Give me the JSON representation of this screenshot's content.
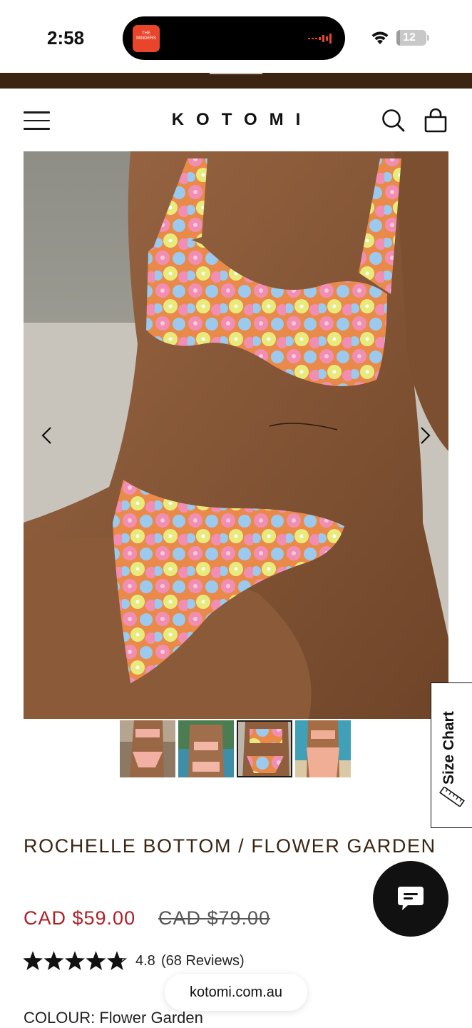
{
  "status_bar": {
    "time": "2:58",
    "now_playing_art_text": "THE MINDERS",
    "battery_level": "12",
    "battery_fraction": 0.12
  },
  "header": {
    "logo": "KOTOMI",
    "icons": [
      "menu-icon",
      "search-icon",
      "cart-icon"
    ]
  },
  "gallery": {
    "main_image_description": "floral bikini product photo",
    "thumbnail_count": 4,
    "active_thumbnail": 2
  },
  "size_chart": {
    "label": "Size Chart"
  },
  "product": {
    "title": "ROCHELLE BOTTOM / FLOWER GARDEN",
    "sale_price": "CAD $59.00",
    "original_price": "CAD $79.00",
    "rating_value": "4.8",
    "review_count": "(68 Reviews)",
    "rating_stars": 4.8,
    "colour_label": "COLOUR: Flower Garden"
  },
  "browser": {
    "url": "kotomi.com.au"
  },
  "colors": {
    "brand_brown": "#3b2512",
    "sale_red": "#b01e24",
    "text_dark": "#1a1a1a"
  }
}
